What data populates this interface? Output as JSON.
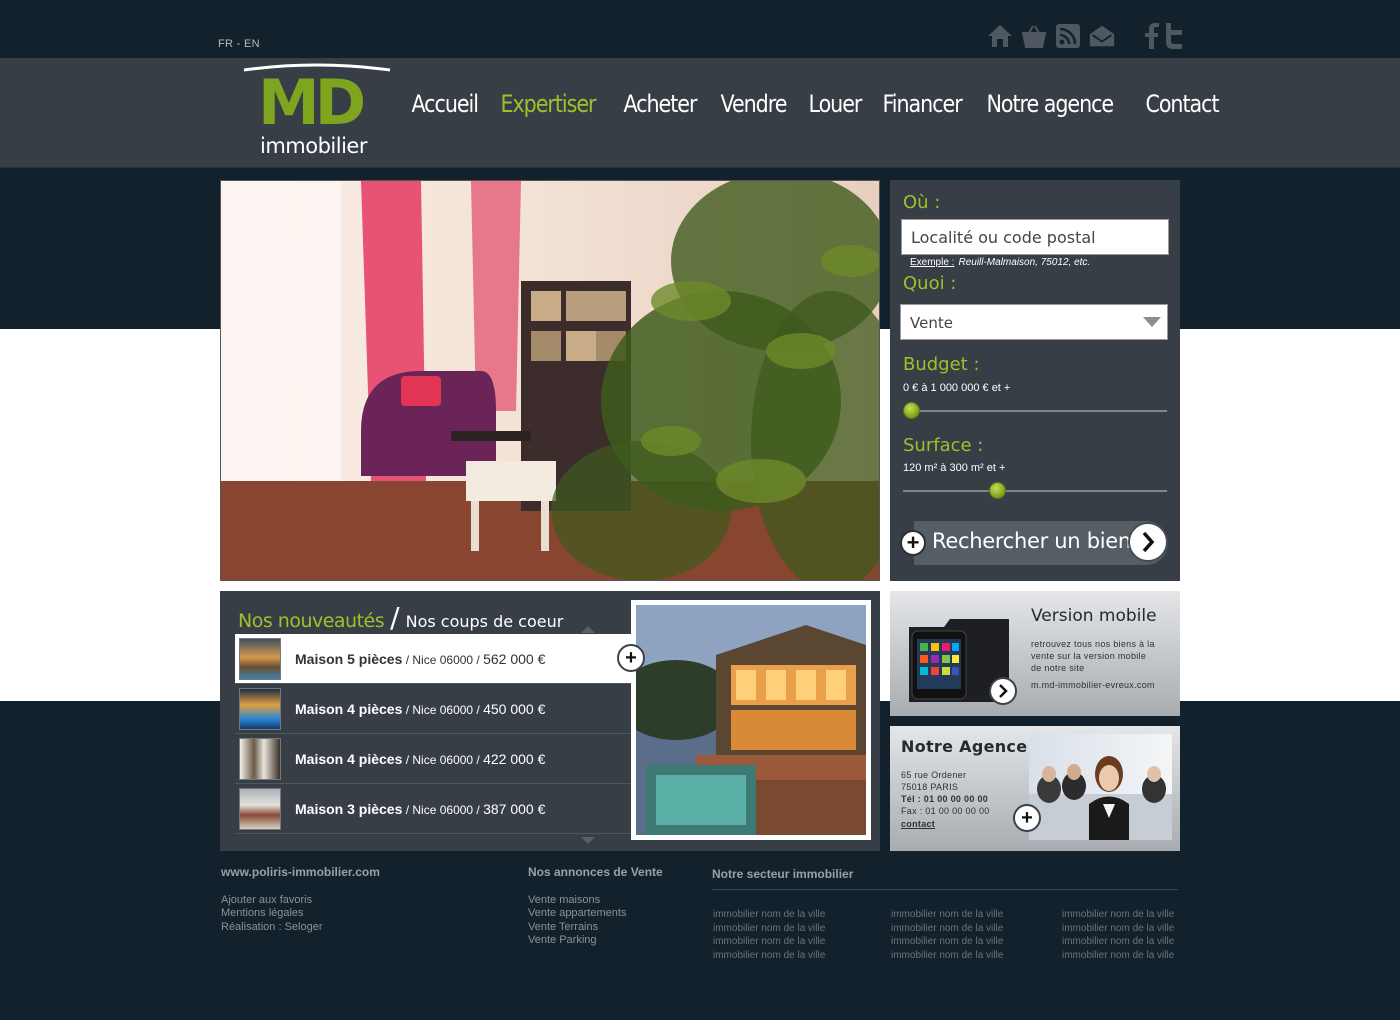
{
  "lang": "FR - EN",
  "top_icons": [
    "home-icon",
    "basket-icon",
    "rss-icon",
    "mail-icon"
  ],
  "social": [
    "facebook-icon",
    "twitter-icon"
  ],
  "logo": {
    "letters": "MD",
    "sub": "immobilier"
  },
  "nav": {
    "items": [
      "Accueil",
      "Expertiser",
      "Acheter",
      "Vendre",
      "Louer",
      "Financer",
      "Notre agence",
      "Contact"
    ],
    "active_index": 1
  },
  "search": {
    "where_label": "Où :",
    "where_placeholder": "Localité ou code postal",
    "example_label": "Exemple :",
    "example_text": "Reuill-Malmaison, 75012, etc.",
    "what_label": "Quoi :",
    "what_value": "Vente",
    "budget_label": "Budget :",
    "budget_range": "0 € à 1 000 000 € et +",
    "budget_fraction": 0.0,
    "surface_label": "Surface :",
    "surface_range": "120 m² à 300 m² et +",
    "surface_fraction": 0.35,
    "button_label": "Rechercher un bien"
  },
  "news": {
    "title_new": "Nos nouveautés",
    "separator": "/",
    "title_fav": "Nos coups de coeur",
    "items": [
      {
        "type": "Maison 5 pièces",
        "place": " / Nice 06000 / ",
        "price": "562 000 €"
      },
      {
        "type": "Maison 4 pièces",
        "place": " / Nice 06000 / ",
        "price": "450 000 €"
      },
      {
        "type": "Maison 4 pièces",
        "place": " / Nice 06000 / ",
        "price": "422 000 €"
      },
      {
        "type": "Maison 3 pièces",
        "place": " / Nice 06000 / ",
        "price": "387 000 €"
      }
    ]
  },
  "mobile": {
    "title": "Version mobile",
    "text_1": "retrouvez tous nos biens à la",
    "text_2": "vente sur la version mobile",
    "text_3": "de notre site",
    "url": "m.md-immobilier-evreux.com"
  },
  "agency": {
    "title": "Notre Agence",
    "address_1": "65 rue Ordener",
    "address_2": "75018 PARIS",
    "tel": "Tél : 01 00 00 00 00",
    "fax": "Fax : 01 00 00 00 00",
    "contact": "contact"
  },
  "footer": {
    "site": "www.poliris-immobilier.com",
    "links": [
      "Ajouter aux favoris",
      "Mentions légales",
      "Réalisation : Seloger"
    ],
    "sales_title": "Nos annonces de Vente",
    "sales_links": [
      "Vente maisons",
      "Vente appartements",
      "Vente Terrains",
      "Vente Parking"
    ],
    "sector_title": "Notre secteur immobilier",
    "city_link": "immobilier nom de la ville"
  }
}
